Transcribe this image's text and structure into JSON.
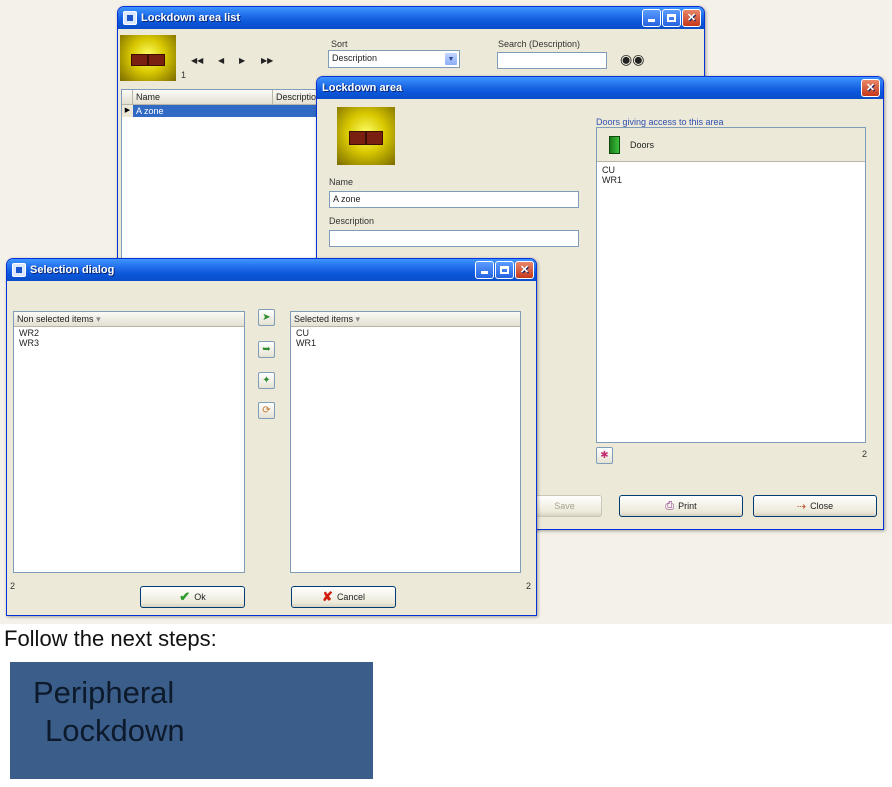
{
  "list_window": {
    "title": "Lockdown area list",
    "record_counter": "1",
    "sort_label": "Sort",
    "sort_value": "Description",
    "search_label": "Search (Description)",
    "search_value": "",
    "columns": [
      "Name",
      "Description"
    ],
    "rows": [
      {
        "name": "A zone",
        "description": ""
      }
    ]
  },
  "area_window": {
    "title": "Lockdown area",
    "name_label": "Name",
    "name_value": "A zone",
    "description_label": "Description",
    "description_value": "",
    "doors_group_label": "Doors giving access to this area",
    "doors_header": "Doors",
    "doors": [
      "CU",
      "WR1"
    ],
    "doors_count": "2",
    "save_label": "Save",
    "print_label": "Print",
    "close_label": "Close"
  },
  "selection_dialog": {
    "title": "Selection dialog",
    "left_header": "Non selected items",
    "left_items": [
      "WR2",
      "WR3"
    ],
    "left_count": "2",
    "right_header": "Selected items",
    "right_items": [
      "CU",
      "WR1"
    ],
    "right_count": "2",
    "ok_label": "Ok",
    "cancel_label": "Cancel"
  },
  "caption": "Follow the next steps:",
  "banner": {
    "line1": "Peripheral",
    "line2": "Lockdown"
  },
  "colors": {
    "xp_title_blue": "#0a55d9",
    "banner_bg": "#3b5d8a",
    "selection_highlight": "#316ac5"
  }
}
